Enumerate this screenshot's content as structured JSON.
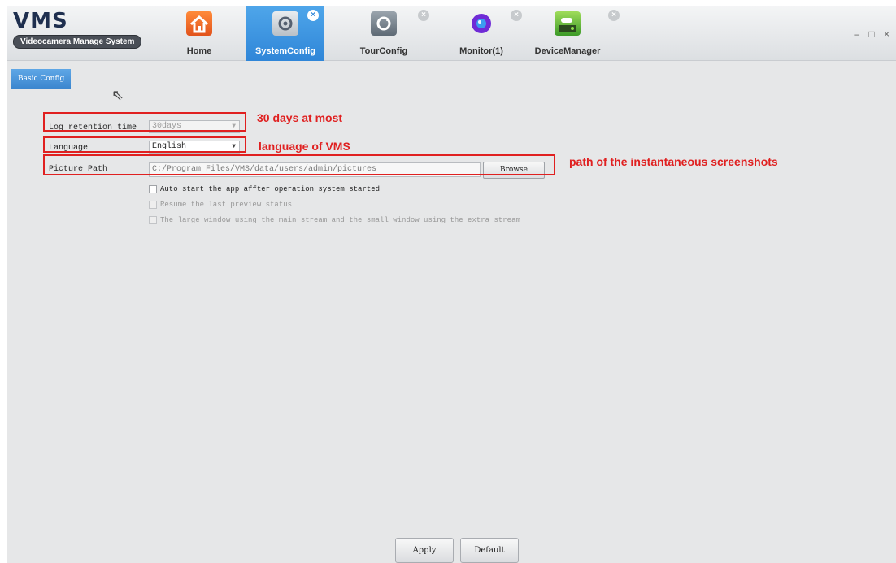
{
  "app": {
    "title": "VMS",
    "subtitle": "Videocamera Manage System"
  },
  "tabs": [
    {
      "label": "Home",
      "icon": "home-icon"
    },
    {
      "label": "SystemConfig",
      "icon": "gear-icon",
      "active": true,
      "close": "×"
    },
    {
      "label": "TourConfig",
      "icon": "tour-icon",
      "close": "×"
    },
    {
      "label": "Monitor(1)",
      "icon": "monitor-icon",
      "close": "×"
    },
    {
      "label": "DeviceManager",
      "icon": "device-icon",
      "close": "×"
    }
  ],
  "window_controls": "– □ ×",
  "subtab": {
    "label": "Basic Config"
  },
  "form": {
    "log_retention": {
      "label": "Log retention time",
      "value": "30days",
      "arrow": "▼"
    },
    "language": {
      "label": "Language",
      "value": "English",
      "arrow": "▼"
    },
    "picture_path": {
      "label": "Picture Path",
      "value": "C:/Program Files/VMS/data/users/admin/pictures",
      "browse": "Browse"
    },
    "checks": [
      {
        "label": "Auto start the app affter operation system started",
        "enabled": true
      },
      {
        "label": "Resume the last preview status",
        "enabled": false
      },
      {
        "label": "The large window using the main stream and the small window using the extra stream",
        "enabled": false
      }
    ]
  },
  "annotations": {
    "log_note": "30 days at most",
    "language_note": "language  of VMS",
    "path_note": "path of the instantaneous screenshots",
    "color": "#e02020"
  },
  "buttons": {
    "apply": "Apply",
    "default": "Default"
  }
}
